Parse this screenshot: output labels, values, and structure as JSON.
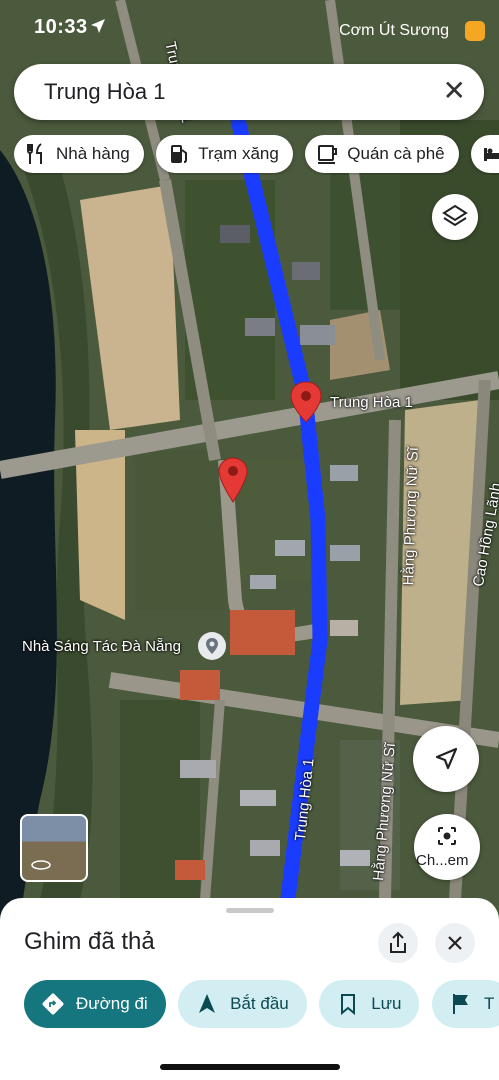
{
  "status_bar": {
    "time": "10:33",
    "carrier": "Cơm Út Sương"
  },
  "search": {
    "query": "Trung Hòa 1",
    "clear_icon": "close-icon"
  },
  "chips": [
    {
      "label": "Nhà hàng",
      "icon": "restaurant-icon"
    },
    {
      "label": "Trạm xăng",
      "icon": "gas-station-icon"
    },
    {
      "label": "Quán cà phê",
      "icon": "coffee-icon"
    },
    {
      "label": "",
      "icon": "hotel-icon"
    }
  ],
  "map": {
    "labels": {
      "pin_label": "Trung Hòa 1",
      "road_upper": "Trung Hòa 1",
      "road_lower": "Trung Hòa 1",
      "street_right": "Hằng Phương Nữ Sĩ",
      "street_right_lower": "Hằng Phương Nữ Sĩ",
      "street_far_right": "Cao Hồng Lãnh",
      "poi": "Nhà Sáng Tác Đà Nẵng"
    },
    "route_color": "#1a3cff"
  },
  "controls": {
    "lens_label": "Ch...em"
  },
  "sheet": {
    "title": "Ghim đã thả",
    "actions": [
      {
        "label": "Đường đi",
        "icon": "directions-icon",
        "style": "primary"
      },
      {
        "label": "Bắt đầu",
        "icon": "navigation-arrow-icon",
        "style": "secondary"
      },
      {
        "label": "Lưu",
        "icon": "bookmark-icon",
        "style": "secondary"
      },
      {
        "label": "T",
        "icon": "flag-icon",
        "style": "secondary"
      }
    ]
  }
}
